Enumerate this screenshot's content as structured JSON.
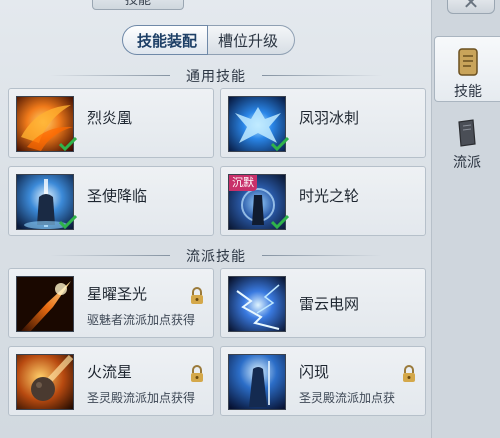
{
  "window": {
    "title": "技能",
    "close_icon": "close-icon"
  },
  "subtabs": [
    {
      "label": "技能装配",
      "active": true
    },
    {
      "label": "槽位升级",
      "active": false
    }
  ],
  "sections": {
    "general": "通用技能",
    "school": "流派技能"
  },
  "general_skills": [
    {
      "name": "烈炎凰",
      "equipped": true,
      "icon": "fire-phoenix-icon"
    },
    {
      "name": "凤羽冰刺",
      "equipped": true,
      "icon": "ice-phoenix-icon"
    },
    {
      "name": "圣使降临",
      "equipped": true,
      "icon": "holy-envoy-icon"
    },
    {
      "name": "时光之轮",
      "equipped": true,
      "silenced_label": "沉默",
      "icon": "time-wheel-icon"
    }
  ],
  "school_skills": [
    {
      "name": "星曜圣光",
      "hint": "驱魅者流派加点获得",
      "locked": true,
      "icon": "starlight-icon"
    },
    {
      "name": "雷云电网",
      "hint": "",
      "locked": false,
      "icon": "thunder-net-icon"
    },
    {
      "name": "火流星",
      "hint": "圣灵殿流派加点获得",
      "locked": true,
      "icon": "meteor-icon"
    },
    {
      "name": "闪现",
      "hint": "圣灵殿流派加点获",
      "locked": true,
      "icon": "blink-icon"
    }
  ],
  "side_nav": [
    {
      "label": "技能",
      "active": true,
      "icon": "scroll-icon"
    },
    {
      "label": "流派",
      "active": false,
      "icon": "book-icon"
    }
  ],
  "colors": {
    "check": "#2fb34a",
    "silence": "#c8306a",
    "accent": "#1d3f66"
  }
}
